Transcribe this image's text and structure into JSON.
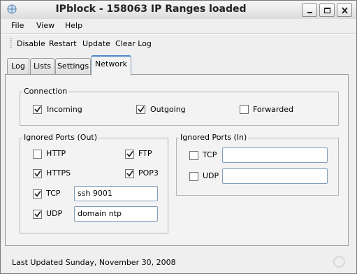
{
  "window": {
    "title": "IPblock - 158063 IP Ranges loaded"
  },
  "menu": [
    "File",
    "View",
    "Help"
  ],
  "toolbar": {
    "disable": "Disable",
    "restart": "Restart",
    "update": "Update",
    "clear_log": "Clear Log"
  },
  "tabs": [
    "Log",
    "Lists",
    "Settings",
    "Network"
  ],
  "active_tab": "Network",
  "connection": {
    "title": "Connection",
    "incoming": {
      "label": "Incoming",
      "checked": true
    },
    "outgoing": {
      "label": "Outgoing",
      "checked": true
    },
    "forwarded": {
      "label": "Forwarded",
      "checked": false
    }
  },
  "ignored_out": {
    "title": "Ignored Ports (Out)",
    "http": {
      "label": "HTTP",
      "checked": false
    },
    "ftp": {
      "label": "FTP",
      "checked": true
    },
    "https": {
      "label": "HTTPS",
      "checked": true
    },
    "pop3": {
      "label": "POP3",
      "checked": true
    },
    "tcp": {
      "label": "TCP",
      "checked": true,
      "value": "ssh 9001"
    },
    "udp": {
      "label": "UDP",
      "checked": true,
      "value": "domain ntp"
    }
  },
  "ignored_in": {
    "title": "Ignored Ports (In)",
    "tcp": {
      "label": "TCP",
      "checked": false,
      "value": ""
    },
    "udp": {
      "label": "UDP",
      "checked": false,
      "value": ""
    }
  },
  "status": "Last Updated Sunday, November 30, 2008",
  "icons": [
    "app-icon",
    "minimize-icon",
    "maximize-icon",
    "close-icon",
    "checkmark-icon",
    "busy-spinner-icon"
  ]
}
